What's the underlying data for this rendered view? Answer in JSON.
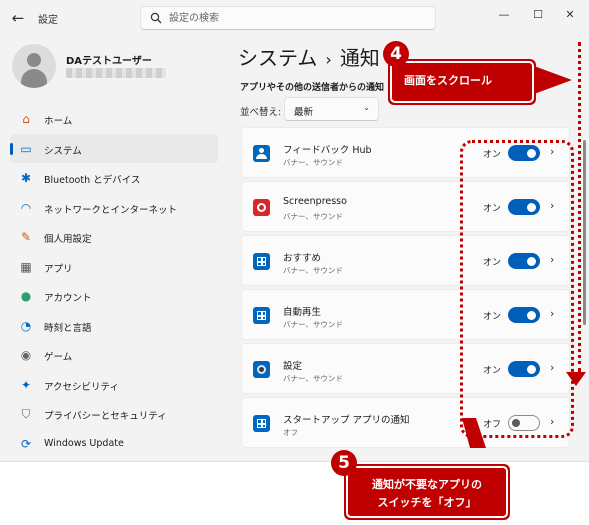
{
  "titlebar": {
    "back_icon": "back-arrow-icon",
    "title": "設定",
    "search_placeholder": "設定の検索",
    "minimize": "—",
    "maximize": "☐",
    "close": "✕"
  },
  "account": {
    "name": "DAテストユーザー"
  },
  "sidebar": {
    "items": [
      {
        "label": "ホーム",
        "icon": "home-icon",
        "glyph": "⌂",
        "color": "#c8581c",
        "active": false
      },
      {
        "label": "システム",
        "icon": "system-icon",
        "glyph": "▭",
        "color": "#0067c0",
        "active": true
      },
      {
        "label": "Bluetooth とデバイス",
        "icon": "bluetooth-icon",
        "glyph": "✱",
        "color": "#0067c0",
        "active": false
      },
      {
        "label": "ネットワークとインターネット",
        "icon": "wifi-icon",
        "glyph": "◠",
        "color": "#0067c0",
        "active": false
      },
      {
        "label": "個人用設定",
        "icon": "brush-icon",
        "glyph": "✎",
        "color": "#c8581c",
        "active": false
      },
      {
        "label": "アプリ",
        "icon": "apps-icon",
        "glyph": "▦",
        "color": "#555555",
        "active": false
      },
      {
        "label": "アカウント",
        "icon": "account-icon",
        "glyph": "●",
        "color": "#2e9e6a",
        "active": false
      },
      {
        "label": "時刻と言語",
        "icon": "globe-clock-icon",
        "glyph": "◔",
        "color": "#0067c0",
        "active": false
      },
      {
        "label": "ゲーム",
        "icon": "gamepad-icon",
        "glyph": "◉",
        "color": "#666666",
        "active": false
      },
      {
        "label": "アクセシビリティ",
        "icon": "accessibility-icon",
        "glyph": "✦",
        "color": "#0067c0",
        "active": false
      },
      {
        "label": "プライバシーとセキュリティ",
        "icon": "shield-icon",
        "glyph": "⛉",
        "color": "#666666",
        "active": false
      },
      {
        "label": "Windows Update",
        "icon": "update-icon",
        "glyph": "⟳",
        "color": "#0067c0",
        "active": false
      }
    ]
  },
  "main": {
    "breadcrumb_parent": "システム",
    "breadcrumb_sep": "›",
    "breadcrumb_current": "通知",
    "section_heading": "アプリやその他の送信者からの通知",
    "sort_label": "並べ替え:",
    "sort_value": "最新",
    "apps": [
      {
        "name": "フィードバック Hub",
        "sub": "バナー、サウンド",
        "state": "オン",
        "on": true,
        "icon": "feedback-hub-icon",
        "color": "#0067c0"
      },
      {
        "name": "Screenpresso",
        "sub": "バナー、サウンド",
        "state": "オン",
        "on": true,
        "icon": "screenpresso-icon",
        "color": "#d8262f"
      },
      {
        "name": "おすすめ",
        "sub": "バナー、サウンド",
        "state": "オン",
        "on": true,
        "icon": "windows-app-icon",
        "color": "#0067c0"
      },
      {
        "name": "自動再生",
        "sub": "バナー、サウンド",
        "state": "オン",
        "on": true,
        "icon": "windows-app-icon",
        "color": "#0067c0"
      },
      {
        "name": "設定",
        "sub": "バナー、サウンド",
        "state": "オン",
        "on": true,
        "icon": "settings-gear-icon",
        "color": "#0067c0"
      },
      {
        "name": "スタートアップ アプリの通知",
        "sub": "オフ",
        "state": "オフ",
        "on": false,
        "icon": "windows-app-icon",
        "color": "#0067c0"
      }
    ]
  },
  "annotations": {
    "step4_number": "4",
    "step4_text": "画面をスクロール",
    "step5_number": "5",
    "step5_line1": "通知が不要なアプリの",
    "step5_line2": "スイッチを「オフ」",
    "accent": "#c00000"
  }
}
